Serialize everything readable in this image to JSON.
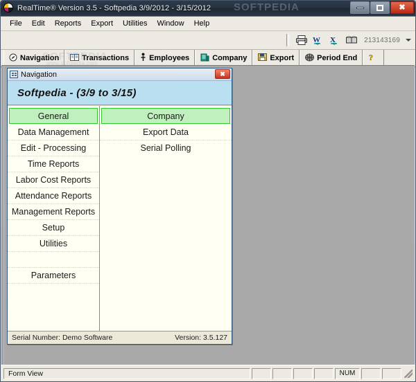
{
  "window": {
    "title": "RealTime®  Version 3.5 - Softpedia 3/9/2012 - 3/15/2012",
    "watermark": "SOFTPEDIA",
    "app_icon": "yinyang-icon",
    "buttons": {
      "minimize": "minimize-icon",
      "maximize": "maximize-icon",
      "close": "✖"
    }
  },
  "menubar": {
    "items": [
      {
        "label": "File"
      },
      {
        "label": "Edit"
      },
      {
        "label": "Reports"
      },
      {
        "label": "Export"
      },
      {
        "label": "Utilities"
      },
      {
        "label": "Window"
      },
      {
        "label": "Help"
      }
    ]
  },
  "toolbar": {
    "icons": [
      "printer-icon",
      "word-export-icon",
      "excel-export-icon",
      "print-preview-icon"
    ],
    "number_value": "213143169",
    "dropdown_caret": "chevron-down-icon"
  },
  "tabstrip": {
    "watermark": "SOFTPEDIA",
    "watermark_sub": "www.softpedia.com",
    "tabs": [
      {
        "label": "Navigation",
        "icon": "compass-icon"
      },
      {
        "label": "Transactions",
        "icon": "book-icon"
      },
      {
        "label": "Employees",
        "icon": "person-icon"
      },
      {
        "label": "Company",
        "icon": "building-icon"
      },
      {
        "label": "Export",
        "icon": "save-export-icon"
      },
      {
        "label": "Period End",
        "icon": "globe-icon"
      },
      {
        "label": "",
        "icon": "help-question-icon"
      }
    ]
  },
  "navigation_window": {
    "caption": "Navigation",
    "icon": "window-grid-icon",
    "close_label": "✖",
    "header": "Softpedia - (3/9  to  3/15)",
    "left_column": [
      {
        "label": "General",
        "type": "header"
      },
      {
        "label": "Data Management",
        "type": "item"
      },
      {
        "label": "Edit - Processing",
        "type": "item"
      },
      {
        "label": "Time Reports",
        "type": "item"
      },
      {
        "label": "Labor Cost Reports",
        "type": "item"
      },
      {
        "label": "Attendance Reports",
        "type": "item"
      },
      {
        "label": "Management Reports",
        "type": "item"
      },
      {
        "label": "Setup",
        "type": "item"
      },
      {
        "label": "Utilities",
        "type": "item"
      },
      {
        "label": "",
        "type": "blank"
      },
      {
        "label": "Parameters",
        "type": "item"
      }
    ],
    "right_column": [
      {
        "label": "Company",
        "type": "header"
      },
      {
        "label": "Export Data",
        "type": "item"
      },
      {
        "label": "Serial Polling",
        "type": "item"
      }
    ],
    "status": {
      "serial": "Serial Number: Demo Software",
      "version": "Version: 3.5.127"
    }
  },
  "statusbar": {
    "message": "Form View",
    "num_indicator": "NUM",
    "empty_panes": 4,
    "trailing_panes": 2
  },
  "colors": {
    "header_green_fill": "#bff0bd",
    "header_green_border": "#2ecb2e",
    "nav_header_blue": "#b9dff0",
    "mdi_gray": "#a9a9a9",
    "close_red": "#c53320"
  }
}
